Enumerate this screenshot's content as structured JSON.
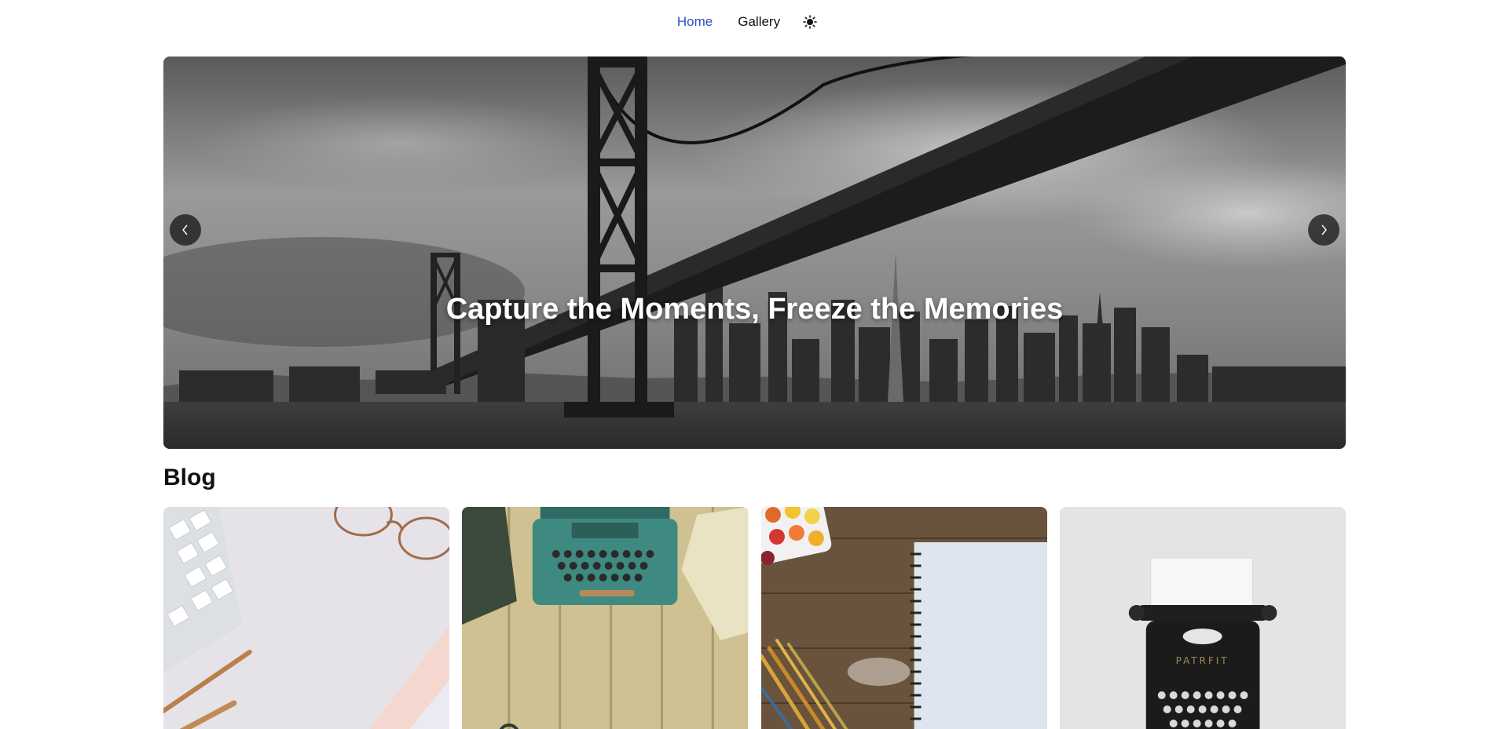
{
  "nav": {
    "items": [
      {
        "label": "Home",
        "active": true
      },
      {
        "label": "Gallery",
        "active": false
      }
    ],
    "theme_toggle_icon": "sun-icon"
  },
  "hero": {
    "caption": "Capture the Moments, Freeze the Memories",
    "prev_icon": "chevron-left-icon",
    "next_icon": "chevron-right-icon"
  },
  "blog": {
    "heading": "Blog",
    "cards": [
      {
        "image": "desk-keyboard-glasses-pen"
      },
      {
        "image": "teal-typewriter-on-wood"
      },
      {
        "image": "watercolor-palette-notebook-brushes"
      },
      {
        "image": "black-typewriter-on-white"
      }
    ]
  },
  "colors": {
    "nav_active": "#2b4fc4",
    "text": "#111111",
    "background": "#ffffff"
  }
}
